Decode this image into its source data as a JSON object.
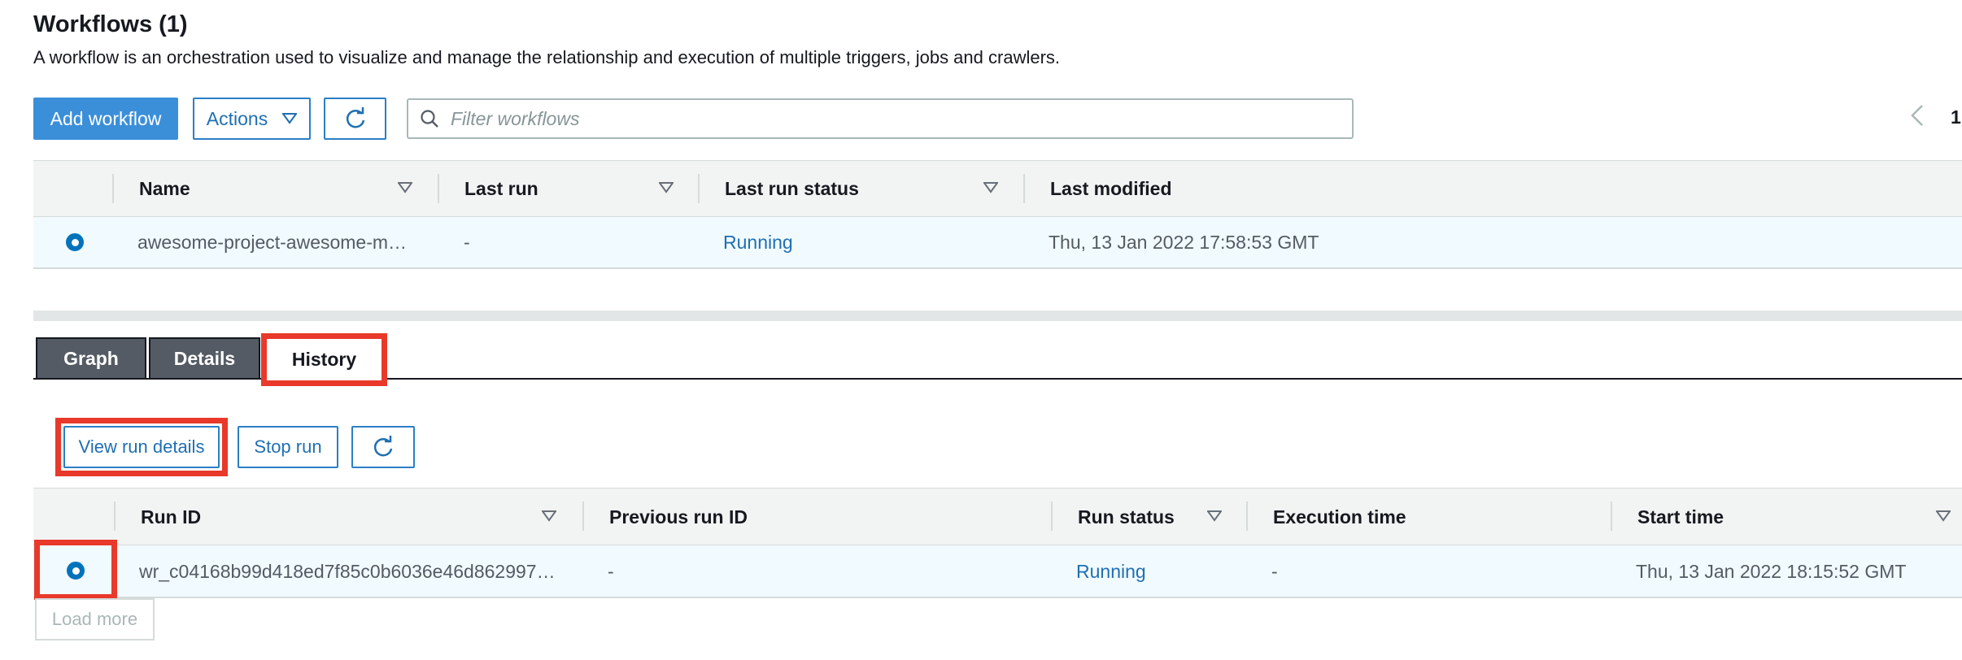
{
  "header": {
    "title": "Workflows (1)",
    "description": "A workflow is an orchestration used to visualize and manage the relationship and execution of multiple triggers, jobs and crawlers."
  },
  "toolbar": {
    "add_label": "Add workflow",
    "actions_label": "Actions",
    "refresh_icon": "refresh-icon",
    "search_placeholder": "Filter workflows",
    "page_number": "1"
  },
  "workflows_table": {
    "columns": [
      "Name",
      "Last run",
      "Last run status",
      "Last modified"
    ],
    "rows": [
      {
        "name": "awesome-project-awesome-m…",
        "last_run": "-",
        "last_run_status": "Running",
        "last_modified": "Thu, 13 Jan 2022 17:58:53 GMT",
        "selected": true
      }
    ]
  },
  "tabs": [
    {
      "label": "Graph",
      "active": false
    },
    {
      "label": "Details",
      "active": false
    },
    {
      "label": "History",
      "active": true
    }
  ],
  "history": {
    "view_run_details_label": "View run details",
    "stop_run_label": "Stop run",
    "columns": [
      "Run ID",
      "Previous run ID",
      "Run status",
      "Execution time",
      "Start time"
    ],
    "rows": [
      {
        "run_id": "wr_c04168b99d418ed7f85c0b6036e46d862997…",
        "previous_run_id": "-",
        "run_status": "Running",
        "execution_time": "-",
        "start_time": "Thu, 13 Jan 2022 18:15:52 GMT",
        "selected": true
      }
    ],
    "load_more_label": "Load more"
  },
  "colors": {
    "primary": "#3b8fd9",
    "link": "#1f6fb2",
    "highlight": "#e8392a",
    "selected_row": "#f1faff"
  }
}
